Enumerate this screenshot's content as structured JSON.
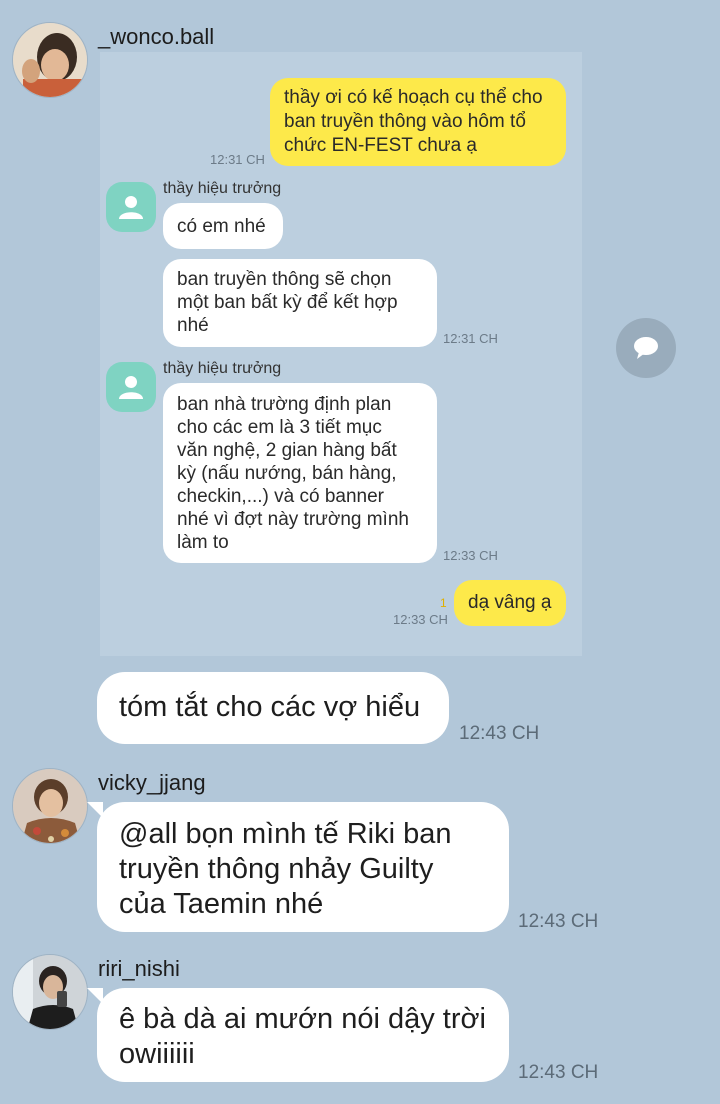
{
  "messages": {
    "first": {
      "sender": "_wonco.ball",
      "text": "tóm tắt cho các vợ hiểu",
      "time": "12:43 CH"
    },
    "second": {
      "sender": "vicky_jjang",
      "lines": [
        "@all bọn mình tế Riki ban",
        "truyền thông nhảy Guilty",
        "của Taemin nhé"
      ],
      "time": "12:43 CH"
    },
    "third": {
      "sender": "riri_nishi",
      "lines": [
        "ê bà dà ai mướn nói dậy trời",
        "owiiiiii"
      ],
      "time": "12:43 CH"
    }
  },
  "screenshot": {
    "q_lines": [
      "thầy ơi có kế hoạch cụ thể cho",
      "ban truyền thông vào hôm tổ",
      "chức EN-FEST chưa ạ"
    ],
    "q_time": "12:31 CH",
    "teacher_name": "thầy hiệu trưởng",
    "r1": "có em nhé",
    "r2_lines": [
      "ban truyền thông sẽ chọn",
      "một ban bất kỳ để kết hợp",
      "nhé"
    ],
    "r2_time": "12:31 CH",
    "r3_lines": [
      "ban nhà trường định plan",
      "cho các em là 3 tiết mục",
      "văn nghệ, 2 gian hàng bất",
      "kỳ (nấu nướng, bán hàng,",
      "checkin,...) và có banner",
      "nhé vì đợt này trường mình",
      "làm to"
    ],
    "r3_time": "12:33 CH",
    "reply": "dạ vâng ạ",
    "reply_read": "1",
    "reply_time": "12:33 CH"
  },
  "icons": {
    "share": "share-speech-icon",
    "person": "person-icon"
  },
  "colors": {
    "background": "#b2c7d9",
    "yellow_bubble": "#fde94a",
    "bubble": "#ffffff"
  }
}
